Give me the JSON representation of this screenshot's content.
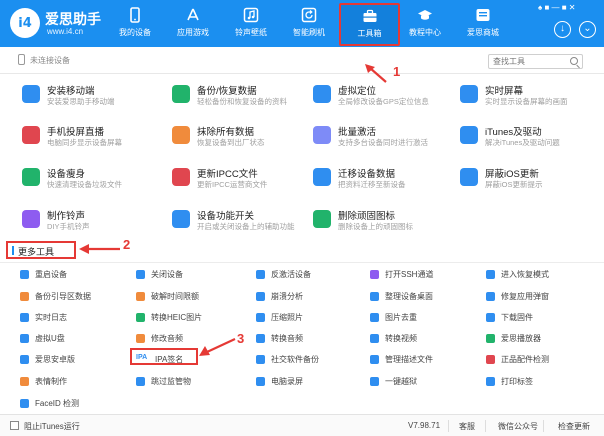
{
  "app": {
    "brand": "爱思助手",
    "url": "www.i4.cn",
    "logo_text": "i4"
  },
  "nav": [
    {
      "label": "我的设备",
      "icon": "phone-icon"
    },
    {
      "label": "应用游戏",
      "icon": "app-store-icon"
    },
    {
      "label": "铃声壁纸",
      "icon": "music-icon"
    },
    {
      "label": "智能刷机",
      "icon": "refresh-box-icon"
    },
    {
      "label": "工具箱",
      "icon": "toolbox-icon",
      "active": true
    },
    {
      "label": "教程中心",
      "icon": "graduation-cap-icon"
    },
    {
      "label": "爱思商城",
      "icon": "store-icon"
    }
  ],
  "window": {
    "controls": "♠ ■ — ■ ✕"
  },
  "status": {
    "text": "未连接设备",
    "search_placeholder": "查找工具"
  },
  "tools": [
    {
      "title": "安装移动端",
      "sub": "安装爱思助手移动端",
      "icon": "install-mobile-icon",
      "color": "#2f8ef0"
    },
    {
      "title": "备份/恢复数据",
      "sub": "轻松备份和恢复设备的资料",
      "icon": "layers-backup-icon",
      "color": "#21b36b"
    },
    {
      "title": "虚拟定位",
      "sub": "全局修改设备GPS定位信息",
      "icon": "location-pin-icon",
      "color": "#2f8ef0"
    },
    {
      "title": "实时屏幕",
      "sub": "实时显示设备屏幕的画面",
      "icon": "screen-icon",
      "color": "#2f8ef0"
    },
    {
      "title": "手机投屏直播",
      "sub": "电脑同步显示设备屏幕",
      "icon": "cast-icon",
      "color": "#e0464f"
    },
    {
      "title": "抹除所有数据",
      "sub": "恢复设备到出厂状态",
      "icon": "erase-icon",
      "color": "#f08b3c"
    },
    {
      "title": "批量激活",
      "sub": "支持多台设备同时进行激活",
      "icon": "batch-activate-icon",
      "color": "#7e8bf7"
    },
    {
      "title": "iTunes及驱动",
      "sub": "解决iTunes及驱动问题",
      "icon": "itunes-icon",
      "color": "#2f8ef0"
    },
    {
      "title": "设备瘦身",
      "sub": "快速清理设备垃圾文件",
      "icon": "slim-device-icon",
      "color": "#21b36b"
    },
    {
      "title": "更新IPCC文件",
      "sub": "更新IPCC运营商文件",
      "icon": "ipcc-icon",
      "color": "#e0464f"
    },
    {
      "title": "迁移设备数据",
      "sub": "把资料迁移至新设备",
      "icon": "migrate-icon",
      "color": "#2f8ef0"
    },
    {
      "title": "屏蔽iOS更新",
      "sub": "屏蔽iOS更新提示",
      "icon": "block-update-icon",
      "color": "#2f8ef0"
    },
    {
      "title": "制作铃声",
      "sub": "DIY手机铃声",
      "icon": "ringtone-icon",
      "color": "#8e5cf0"
    },
    {
      "title": "设备功能开关",
      "sub": "开启或关闭设备上的辅助功能",
      "icon": "toggle-icon",
      "color": "#2f8ef0"
    },
    {
      "title": "删除顽固图标",
      "sub": "删除设备上的顽固图标",
      "icon": "delete-icon-icon",
      "color": "#21b36b"
    }
  ],
  "more": {
    "label": "更多工具"
  },
  "small_tools": [
    {
      "label": "重启设备",
      "icon": "restart-icon",
      "color": "#2f8ef0"
    },
    {
      "label": "关闭设备",
      "icon": "power-icon",
      "color": "#2f8ef0"
    },
    {
      "label": "反激活设备",
      "icon": "deactivate-icon",
      "color": "#2f8ef0"
    },
    {
      "label": "打开SSH通道",
      "icon": "ssh-icon",
      "color": "#8e5cf0"
    },
    {
      "label": "进入恢复模式",
      "icon": "recovery-icon",
      "color": "#2f8ef0"
    },
    {
      "label": "备份引导区数据",
      "icon": "backup-boot-icon",
      "color": "#f08b3c"
    },
    {
      "label": "破解时间限额",
      "icon": "time-limit-icon",
      "color": "#f08b3c"
    },
    {
      "label": "崩溃分析",
      "icon": "crash-icon",
      "color": "#2f8ef0"
    },
    {
      "label": "整理设备桌面",
      "icon": "desktop-icon",
      "color": "#2f8ef0"
    },
    {
      "label": "修复应用弹窗",
      "icon": "fix-popup-icon",
      "color": "#2f8ef0"
    },
    {
      "label": "实时日志",
      "icon": "log-icon",
      "color": "#2f8ef0"
    },
    {
      "label": "转换HEIC图片",
      "icon": "heic-icon",
      "color": "#21b36b"
    },
    {
      "label": "压缩照片",
      "icon": "compress-icon",
      "color": "#2f8ef0"
    },
    {
      "label": "图片去重",
      "icon": "dedup-icon",
      "color": "#2f8ef0"
    },
    {
      "label": "下载固件",
      "icon": "download-icon",
      "color": "#2f8ef0"
    },
    {
      "label": "虚拟U盘",
      "icon": "udisk-icon",
      "color": "#2f8ef0"
    },
    {
      "label": "修改音频",
      "icon": "audio-icon",
      "color": "#f08b3c"
    },
    {
      "label": "转换音频",
      "icon": "convert-audio-icon",
      "color": "#2f8ef0"
    },
    {
      "label": "转换视频",
      "icon": "convert-video-icon",
      "color": "#2f8ef0"
    },
    {
      "label": "爱思播放器",
      "icon": "player-icon",
      "color": "#21b36b"
    },
    {
      "label": "爱思安卓版",
      "icon": "android-icon",
      "color": "#2f8ef0"
    },
    {
      "label": "IPA签名",
      "icon": "ipa-icon",
      "color": "#2f8ef0",
      "badge": "IPA"
    },
    {
      "label": "社交软件备份",
      "icon": "social-backup-icon",
      "color": "#2f8ef0"
    },
    {
      "label": "管理描述文件",
      "icon": "profile-icon",
      "color": "#2f8ef0"
    },
    {
      "label": "正品配件检测",
      "icon": "accessory-icon",
      "color": "#e0464f"
    },
    {
      "label": "表情制作",
      "icon": "emoji-icon",
      "color": "#f08b3c"
    },
    {
      "label": "跳过监管物",
      "icon": "skip-icon",
      "color": "#2f8ef0"
    },
    {
      "label": "电脑录屏",
      "icon": "record-icon",
      "color": "#2f8ef0"
    },
    {
      "label": "一键越狱",
      "icon": "jailbreak-icon",
      "color": "#2f8ef0"
    },
    {
      "label": "打印标签",
      "icon": "print-icon",
      "color": "#2f8ef0"
    },
    {
      "label": "FaceID 检测",
      "icon": "faceid-icon",
      "color": "#2f8ef0"
    }
  ],
  "annotations": {
    "n1": "1",
    "n2": "2",
    "n3": "3"
  },
  "bottom": {
    "block_itunes": "阻止iTunes运行",
    "version": "V7.98.71",
    "service": "客服",
    "wechat": "微信公众号",
    "check_update": "检查更新"
  }
}
